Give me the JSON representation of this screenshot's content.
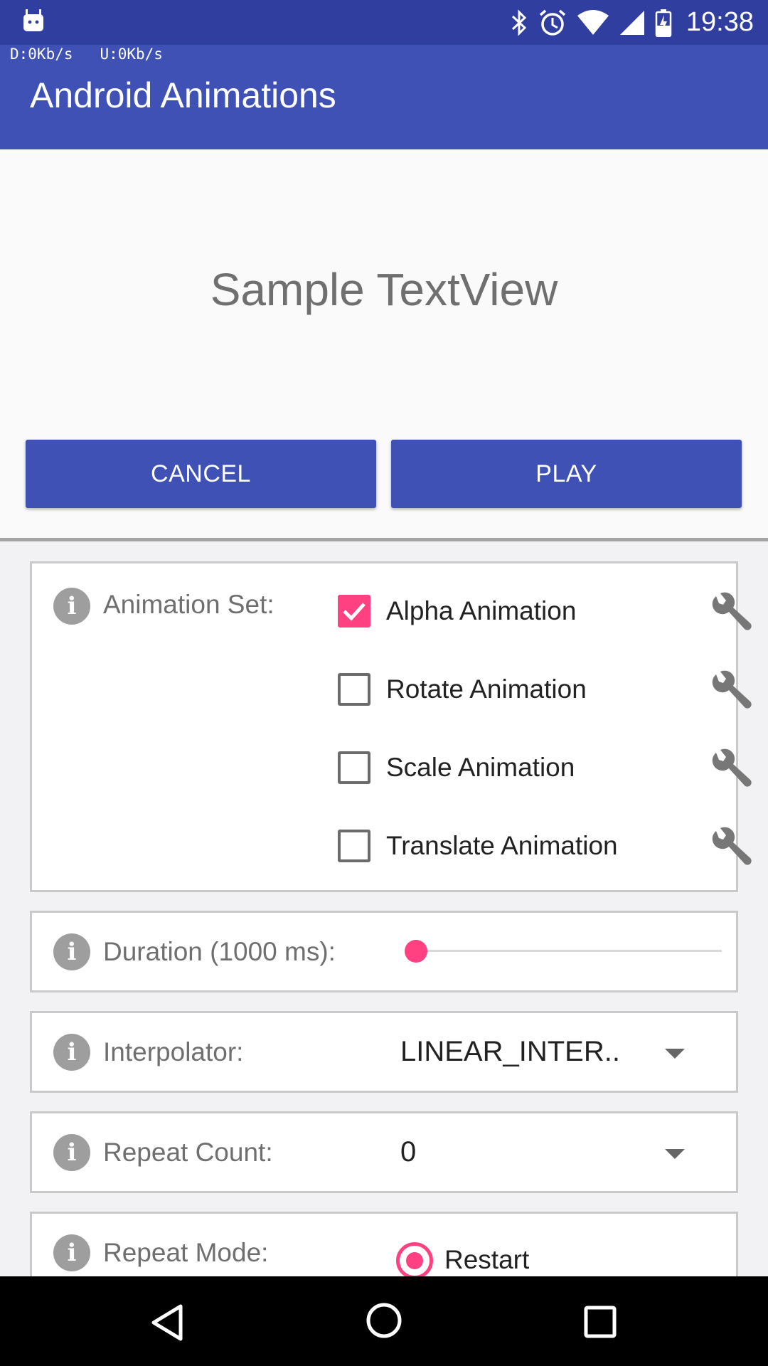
{
  "status_bar": {
    "time": "19:38",
    "icons": [
      "android-robot-icon",
      "bluetooth-icon",
      "alarm-icon",
      "wifi-icon",
      "signal-icon",
      "battery-charging-icon"
    ]
  },
  "net_speed": {
    "down": "D:0Kb/s",
    "up": "U:0Kb/s"
  },
  "app_bar": {
    "title": "Android Animations"
  },
  "preview": {
    "sample_text": "Sample TextView"
  },
  "buttons": {
    "cancel": "CANCEL",
    "play": "PLAY"
  },
  "animation_set": {
    "label": "Animation Set:",
    "items": [
      {
        "label": "Alpha Animation",
        "checked": true
      },
      {
        "label": "Rotate Animation",
        "checked": false
      },
      {
        "label": "Scale Animation",
        "checked": false
      },
      {
        "label": "Translate Animation",
        "checked": false
      }
    ]
  },
  "duration": {
    "label": "Duration (1000 ms):",
    "slider_fraction": 0.0
  },
  "interpolator": {
    "label": "Interpolator:",
    "value": "LINEAR_INTER.."
  },
  "repeat_count": {
    "label": "Repeat Count:",
    "value": "0"
  },
  "repeat_mode": {
    "label": "Repeat Mode:",
    "selected_option": "Restart"
  },
  "colors": {
    "primary": "#3f51b5",
    "primary_dark": "#303f9f",
    "accent": "#ff4081"
  },
  "nav_bar": {
    "icons": [
      "back-icon",
      "home-icon",
      "recents-icon"
    ]
  }
}
